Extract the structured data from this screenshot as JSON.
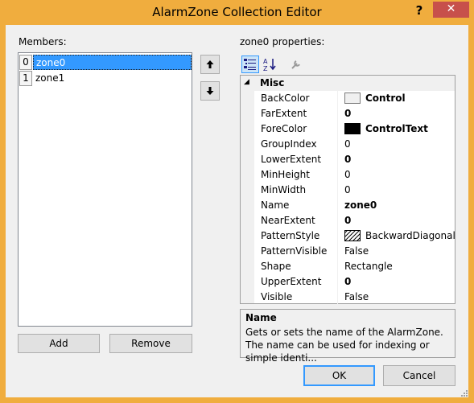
{
  "window": {
    "title": "AlarmZone Collection Editor",
    "help_glyph": "?",
    "close_glyph": "✕"
  },
  "members": {
    "label": "Members:",
    "items": [
      {
        "index": "0",
        "name": "zone0",
        "selected": true
      },
      {
        "index": "1",
        "name": "zone1",
        "selected": false
      }
    ],
    "add_label": "Add",
    "remove_label": "Remove",
    "up_glyph": "🡡",
    "down_glyph": "🡣"
  },
  "properties": {
    "label": "zone0 properties:",
    "toolbar": [
      "categorized-icon",
      "alphabetical-icon",
      "property-pages-icon"
    ],
    "category": "Misc",
    "rows": [
      {
        "name": "BackColor",
        "value": "Control",
        "bold": true,
        "swatch": "#f0f0f0"
      },
      {
        "name": "FarExtent",
        "value": "0",
        "bold": true
      },
      {
        "name": "ForeColor",
        "value": "ControlText",
        "bold": true,
        "swatch": "#000000"
      },
      {
        "name": "GroupIndex",
        "value": "0",
        "bold": false
      },
      {
        "name": "LowerExtent",
        "value": "0",
        "bold": true
      },
      {
        "name": "MinHeight",
        "value": "0",
        "bold": false
      },
      {
        "name": "MinWidth",
        "value": "0",
        "bold": false
      },
      {
        "name": "Name",
        "value": "zone0",
        "bold": true
      },
      {
        "name": "NearExtent",
        "value": "0",
        "bold": true
      },
      {
        "name": "PatternStyle",
        "value": "BackwardDiagonal",
        "bold": false,
        "pattern": true
      },
      {
        "name": "PatternVisible",
        "value": "False",
        "bold": false
      },
      {
        "name": "Shape",
        "value": "Rectangle",
        "bold": false
      },
      {
        "name": "UpperExtent",
        "value": "0",
        "bold": true
      },
      {
        "name": "Visible",
        "value": "False",
        "bold": false
      }
    ],
    "description": {
      "title": "Name",
      "text": "Gets or sets the name of the AlarmZone.  The name can be used for indexing or simple identi..."
    }
  },
  "buttons": {
    "ok_label": "OK",
    "cancel_label": "Cancel"
  },
  "colors": {
    "frame": "#f0ad3e",
    "selection": "#3399ff",
    "close": "#c7504b"
  }
}
